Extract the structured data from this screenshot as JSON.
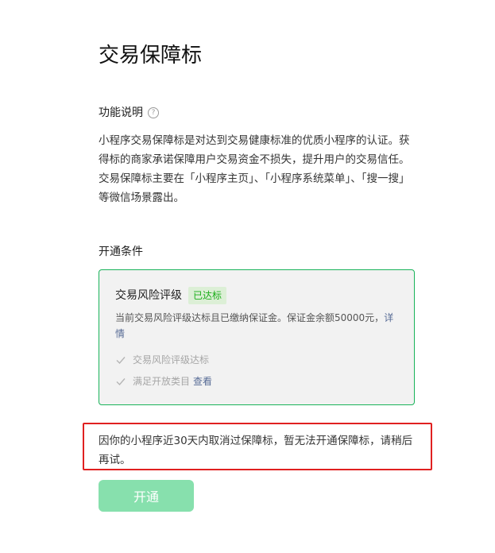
{
  "page": {
    "title": "交易保障标"
  },
  "function": {
    "title": "功能说明",
    "help_icon": "help-circle-icon",
    "description_lines": [
      "小程序交易保障标是对达到交易健康标准的优质小程序的认证。获得标的商家承诺保障用户交易资金不损失，提升用户的交易信任。",
      "交易保障标主要在「小程序主页」、「小程序系统菜单」、「搜一搜」等微信场景露出。"
    ]
  },
  "conditions": {
    "title": "开通条件",
    "item": {
      "name": "交易风险评级",
      "badge": "已达标",
      "desc": "当前交易风险评级达标且已缴纳保证金。保证金余额50000元，",
      "desc_link": "详情"
    },
    "checks": [
      {
        "label": "交易风险评级达标",
        "link": ""
      },
      {
        "label": "满足开放类目",
        "link": "查看"
      }
    ]
  },
  "notice": {
    "text": "因你的小程序近30天内取消过保障标，暂无法开通保障标，请稍后再试。"
  },
  "actions": {
    "open_label": "开通"
  },
  "colors": {
    "accent": "#19b35a",
    "badge_bg": "#dcefd6",
    "badge_text": "#1aad19",
    "link": "#576b95",
    "notice_border": "#e02020",
    "button_disabled": "#87e0ad",
    "box_bg": "#f2f2f2"
  }
}
